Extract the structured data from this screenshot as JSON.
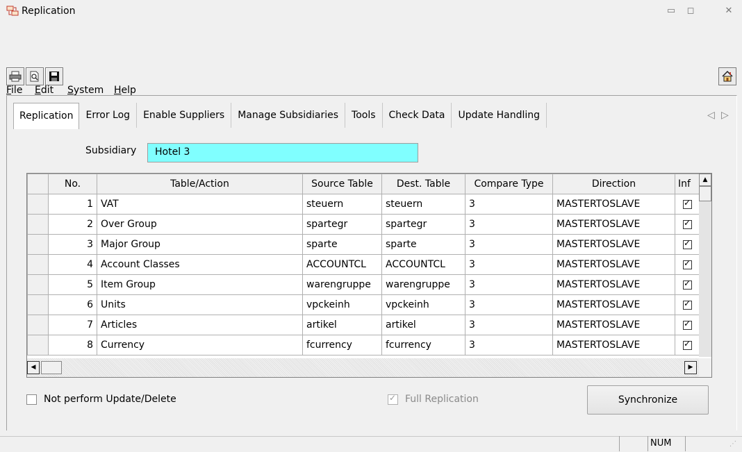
{
  "window": {
    "title": "Replication",
    "minimize": "▭",
    "maximize": "◻",
    "close": "✕"
  },
  "menu": [
    {
      "key": "F",
      "rest": "ile"
    },
    {
      "key": "E",
      "rest": "dit"
    },
    {
      "key": "S",
      "rest": "ystem"
    },
    {
      "key": "H",
      "rest": "elp"
    }
  ],
  "tabs": [
    "Replication",
    "Error Log",
    "Enable Suppliers",
    "Manage Subsidiaries",
    "Tools",
    "Check Data",
    "Update Handling"
  ],
  "subsidiary": {
    "label": "Subsidiary",
    "value": "Hotel 3"
  },
  "grid": {
    "columns": [
      "No.",
      "Table/Action",
      "Source Table",
      "Dest. Table",
      "Compare Type",
      "Direction",
      "Inf"
    ],
    "rows": [
      {
        "no": "1",
        "action": "VAT",
        "source": "steuern",
        "dest": "steuern",
        "compare": "3",
        "direction": "MASTERTOSLAVE",
        "checked": true
      },
      {
        "no": "2",
        "action": "Over Group",
        "source": "spartegr",
        "dest": "spartegr",
        "compare": "3",
        "direction": "MASTERTOSLAVE",
        "checked": true
      },
      {
        "no": "3",
        "action": "Major Group",
        "source": "sparte",
        "dest": "sparte",
        "compare": "3",
        "direction": "MASTERTOSLAVE",
        "checked": true
      },
      {
        "no": "4",
        "action": "Account Classes",
        "source": "ACCOUNTCL",
        "dest": "ACCOUNTCL",
        "compare": "3",
        "direction": "MASTERTOSLAVE",
        "checked": true
      },
      {
        "no": "5",
        "action": "Item Group",
        "source": "warengruppe",
        "dest": "warengruppe",
        "compare": "3",
        "direction": "MASTERTOSLAVE",
        "checked": true
      },
      {
        "no": "6",
        "action": "Units",
        "source": "vpckeinh",
        "dest": "vpckeinh",
        "compare": "3",
        "direction": "MASTERTOSLAVE",
        "checked": true
      },
      {
        "no": "7",
        "action": "Articles",
        "source": "artikel",
        "dest": "artikel",
        "compare": "3",
        "direction": "MASTERTOSLAVE",
        "checked": true
      },
      {
        "no": "8",
        "action": "Currency",
        "source": "fcurrency",
        "dest": "fcurrency",
        "compare": "3",
        "direction": "MASTERTOSLAVE",
        "checked": true
      }
    ]
  },
  "options": {
    "not_perform_label": "Not perform Update/Delete",
    "full_replication_label": "Full Replication",
    "synchronize_label": "Synchronize"
  },
  "status": {
    "num": "NUM"
  },
  "colors": {
    "subsidiary_bg": "#80ffff"
  }
}
